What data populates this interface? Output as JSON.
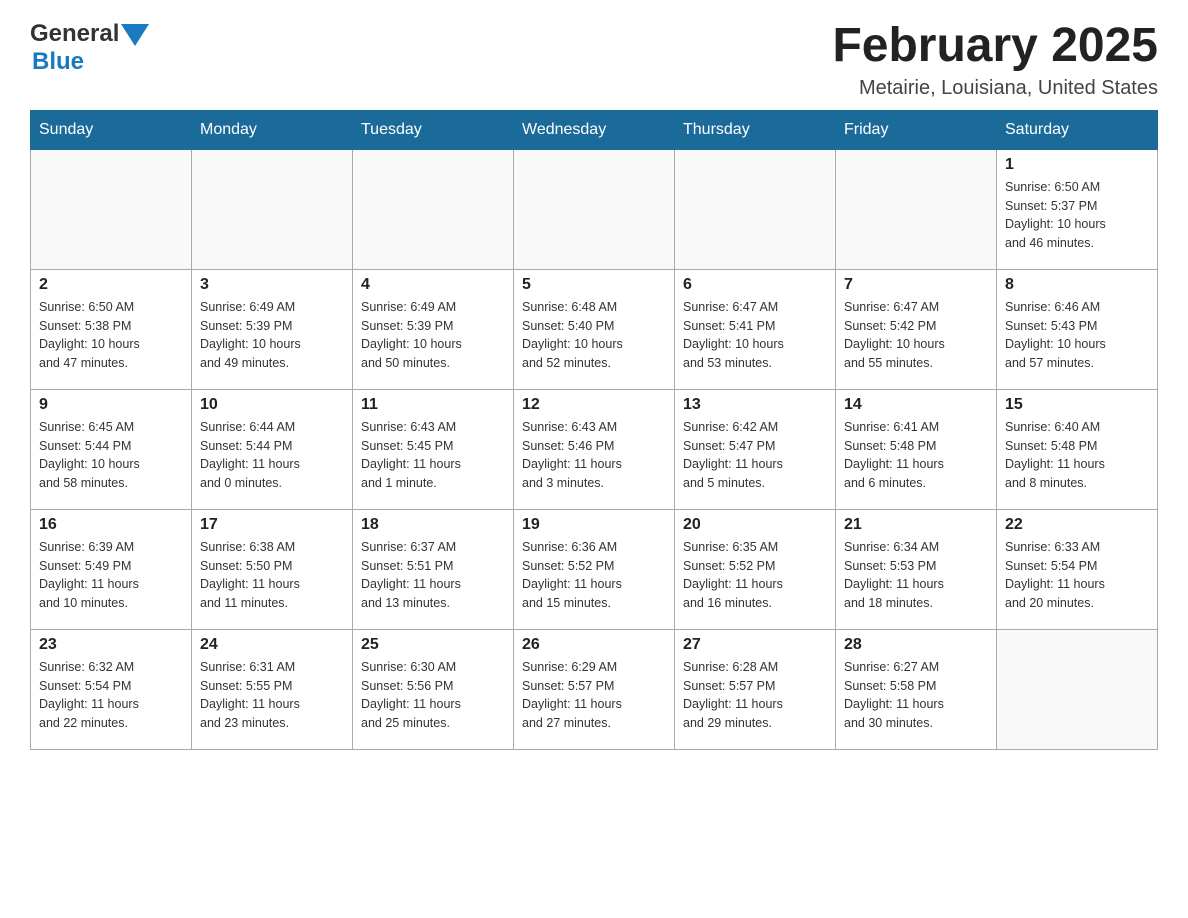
{
  "logo": {
    "text_general": "General",
    "text_blue": "Blue"
  },
  "title": "February 2025",
  "location": "Metairie, Louisiana, United States",
  "days_of_week": [
    "Sunday",
    "Monday",
    "Tuesday",
    "Wednesday",
    "Thursday",
    "Friday",
    "Saturday"
  ],
  "weeks": [
    [
      {
        "day": "",
        "info": ""
      },
      {
        "day": "",
        "info": ""
      },
      {
        "day": "",
        "info": ""
      },
      {
        "day": "",
        "info": ""
      },
      {
        "day": "",
        "info": ""
      },
      {
        "day": "",
        "info": ""
      },
      {
        "day": "1",
        "info": "Sunrise: 6:50 AM\nSunset: 5:37 PM\nDaylight: 10 hours\nand 46 minutes."
      }
    ],
    [
      {
        "day": "2",
        "info": "Sunrise: 6:50 AM\nSunset: 5:38 PM\nDaylight: 10 hours\nand 47 minutes."
      },
      {
        "day": "3",
        "info": "Sunrise: 6:49 AM\nSunset: 5:39 PM\nDaylight: 10 hours\nand 49 minutes."
      },
      {
        "day": "4",
        "info": "Sunrise: 6:49 AM\nSunset: 5:39 PM\nDaylight: 10 hours\nand 50 minutes."
      },
      {
        "day": "5",
        "info": "Sunrise: 6:48 AM\nSunset: 5:40 PM\nDaylight: 10 hours\nand 52 minutes."
      },
      {
        "day": "6",
        "info": "Sunrise: 6:47 AM\nSunset: 5:41 PM\nDaylight: 10 hours\nand 53 minutes."
      },
      {
        "day": "7",
        "info": "Sunrise: 6:47 AM\nSunset: 5:42 PM\nDaylight: 10 hours\nand 55 minutes."
      },
      {
        "day": "8",
        "info": "Sunrise: 6:46 AM\nSunset: 5:43 PM\nDaylight: 10 hours\nand 57 minutes."
      }
    ],
    [
      {
        "day": "9",
        "info": "Sunrise: 6:45 AM\nSunset: 5:44 PM\nDaylight: 10 hours\nand 58 minutes."
      },
      {
        "day": "10",
        "info": "Sunrise: 6:44 AM\nSunset: 5:44 PM\nDaylight: 11 hours\nand 0 minutes."
      },
      {
        "day": "11",
        "info": "Sunrise: 6:43 AM\nSunset: 5:45 PM\nDaylight: 11 hours\nand 1 minute."
      },
      {
        "day": "12",
        "info": "Sunrise: 6:43 AM\nSunset: 5:46 PM\nDaylight: 11 hours\nand 3 minutes."
      },
      {
        "day": "13",
        "info": "Sunrise: 6:42 AM\nSunset: 5:47 PM\nDaylight: 11 hours\nand 5 minutes."
      },
      {
        "day": "14",
        "info": "Sunrise: 6:41 AM\nSunset: 5:48 PM\nDaylight: 11 hours\nand 6 minutes."
      },
      {
        "day": "15",
        "info": "Sunrise: 6:40 AM\nSunset: 5:48 PM\nDaylight: 11 hours\nand 8 minutes."
      }
    ],
    [
      {
        "day": "16",
        "info": "Sunrise: 6:39 AM\nSunset: 5:49 PM\nDaylight: 11 hours\nand 10 minutes."
      },
      {
        "day": "17",
        "info": "Sunrise: 6:38 AM\nSunset: 5:50 PM\nDaylight: 11 hours\nand 11 minutes."
      },
      {
        "day": "18",
        "info": "Sunrise: 6:37 AM\nSunset: 5:51 PM\nDaylight: 11 hours\nand 13 minutes."
      },
      {
        "day": "19",
        "info": "Sunrise: 6:36 AM\nSunset: 5:52 PM\nDaylight: 11 hours\nand 15 minutes."
      },
      {
        "day": "20",
        "info": "Sunrise: 6:35 AM\nSunset: 5:52 PM\nDaylight: 11 hours\nand 16 minutes."
      },
      {
        "day": "21",
        "info": "Sunrise: 6:34 AM\nSunset: 5:53 PM\nDaylight: 11 hours\nand 18 minutes."
      },
      {
        "day": "22",
        "info": "Sunrise: 6:33 AM\nSunset: 5:54 PM\nDaylight: 11 hours\nand 20 minutes."
      }
    ],
    [
      {
        "day": "23",
        "info": "Sunrise: 6:32 AM\nSunset: 5:54 PM\nDaylight: 11 hours\nand 22 minutes."
      },
      {
        "day": "24",
        "info": "Sunrise: 6:31 AM\nSunset: 5:55 PM\nDaylight: 11 hours\nand 23 minutes."
      },
      {
        "day": "25",
        "info": "Sunrise: 6:30 AM\nSunset: 5:56 PM\nDaylight: 11 hours\nand 25 minutes."
      },
      {
        "day": "26",
        "info": "Sunrise: 6:29 AM\nSunset: 5:57 PM\nDaylight: 11 hours\nand 27 minutes."
      },
      {
        "day": "27",
        "info": "Sunrise: 6:28 AM\nSunset: 5:57 PM\nDaylight: 11 hours\nand 29 minutes."
      },
      {
        "day": "28",
        "info": "Sunrise: 6:27 AM\nSunset: 5:58 PM\nDaylight: 11 hours\nand 30 minutes."
      },
      {
        "day": "",
        "info": ""
      }
    ]
  ]
}
